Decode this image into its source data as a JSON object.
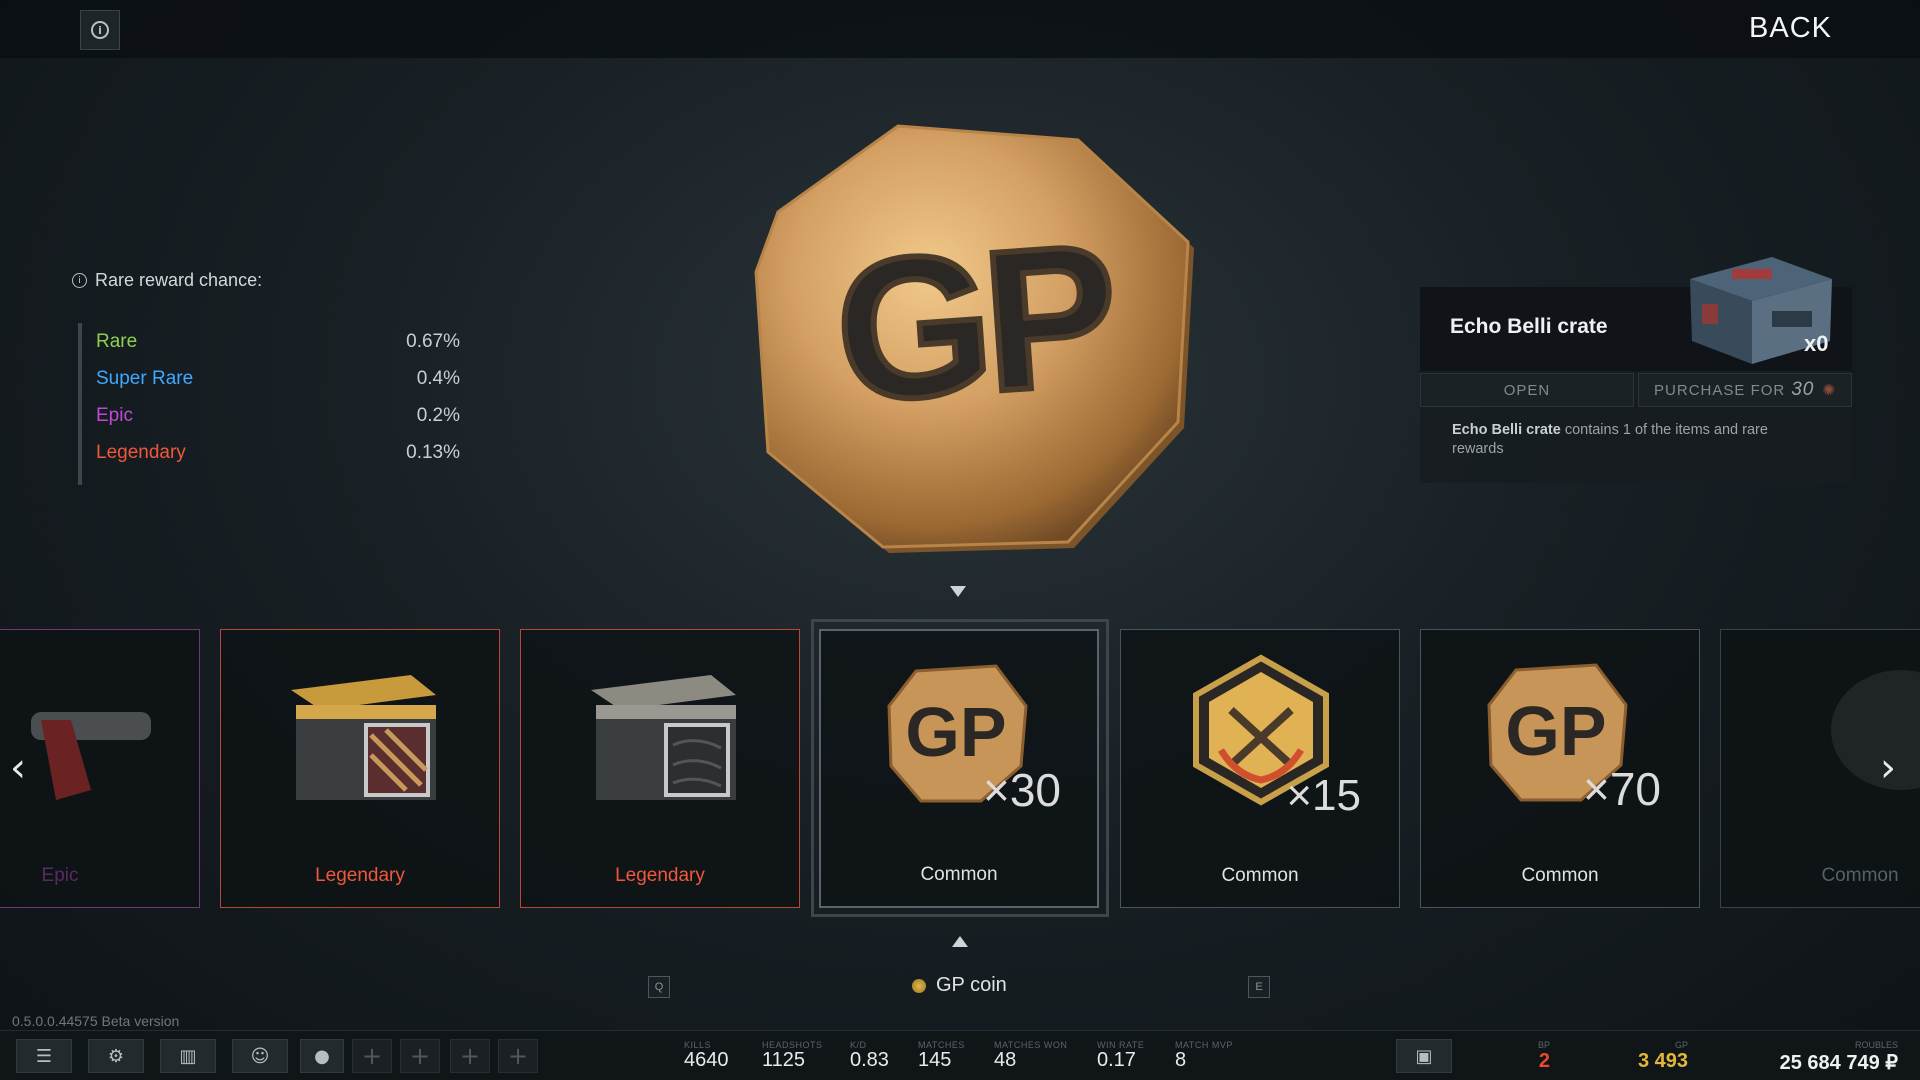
{
  "header": {
    "back_label": "BACK",
    "info_icon": "i"
  },
  "rare_chance": {
    "title": "Rare reward chance:",
    "rows": [
      {
        "name": "Rare",
        "value": "0.67%",
        "color": "#8fd14f"
      },
      {
        "name": "Super Rare",
        "value": "0.4%",
        "color": "#3fa9ff"
      },
      {
        "name": "Epic",
        "value": "0.2%",
        "color": "#c04ad6"
      },
      {
        "name": "Legendary",
        "value": "0.13%",
        "color": "#f0583a"
      }
    ]
  },
  "featured_item": {
    "text": "GP"
  },
  "crate": {
    "name": "Echo Belli crate",
    "count": "x0",
    "open_label": "OPEN",
    "purchase_label": "PURCHASE FOR",
    "purchase_price": "30",
    "desc_bold": "Echo Belli crate",
    "desc_rest": " contains 1 of the items and rare rewards"
  },
  "carousel": {
    "cards": [
      {
        "label": "Epic",
        "color": "#5a2a66",
        "border": "#6c3a78"
      },
      {
        "label": "Legendary",
        "color": "#f0583a",
        "border": "#b8473a"
      },
      {
        "label": "Legendary",
        "color": "#f0583a",
        "border": "#b8473a"
      },
      {
        "label": "Common",
        "color": "#dfe3e5",
        "border": "#4a545a",
        "qty": "×30",
        "gp": "GP"
      },
      {
        "label": "Common",
        "color": "#dfe3e5",
        "border": "#4a545a",
        "qty": "×15"
      },
      {
        "label": "Common",
        "color": "#dfe3e5",
        "border": "#4a545a",
        "qty": "×70",
        "gp": "GP"
      },
      {
        "label": "Common",
        "color": "#55606a",
        "border": "#3a4349"
      }
    ],
    "prev_key": "Q",
    "next_key": "E",
    "selected_name": "GP coin"
  },
  "version": "0.5.0.0.44575 Beta version",
  "stats": [
    {
      "label": "KILLS",
      "value": "4640"
    },
    {
      "label": "HEADSHOTS",
      "value": "1125"
    },
    {
      "label": "K/D",
      "value": "0.83"
    },
    {
      "label": "MATCHES",
      "value": "145"
    },
    {
      "label": "MATCHES WON",
      "value": "48"
    },
    {
      "label": "WIN RATE",
      "value": "0.17"
    },
    {
      "label": "MATCH MVP",
      "value": "8"
    }
  ],
  "currency": {
    "bp": {
      "label": "BP",
      "value": "2",
      "color": "#e84a2e"
    },
    "gp": {
      "label": "GP",
      "value": "3 493",
      "color": "#e2b73a"
    },
    "roubles": {
      "label": "ROUBLES",
      "value": "25 684 749 ₽",
      "color": "#eef1f2"
    }
  },
  "icons": {
    "menu": "menu-icon",
    "settings": "gear-icon",
    "inventory": "inventory-icon",
    "friends": "friends-icon",
    "avatar": "avatar-icon",
    "save": "save-icon"
  }
}
